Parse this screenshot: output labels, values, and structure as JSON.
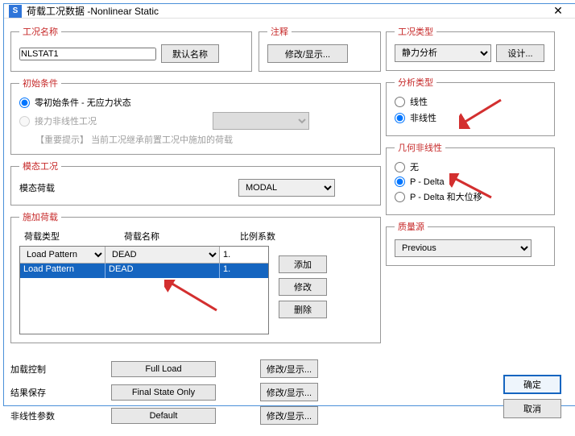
{
  "window": {
    "appicon_text": "S",
    "title": "荷载工况数据 -Nonlinear Static",
    "close_glyph": "✕"
  },
  "left": {
    "name_group": "工况名称",
    "name_value": "NLSTAT1",
    "default_name_btn": "默认名称",
    "comment_group": "注释",
    "comment_btn": "修改/显示...",
    "initial_group": "初始条件",
    "radio_zero": "零初始条件 - 无应力状态",
    "radio_cont": "接力非线性工况",
    "hint_label": "【重要提示】",
    "hint_text": "当前工况继承前置工况中施加的荷载",
    "modal_group": "模态工况",
    "modal_load_label": "模态荷载",
    "modal_select": "MODAL",
    "applied_group": "施加荷载",
    "col_type": "荷载类型",
    "col_name": "荷载名称",
    "col_scale": "比例系数",
    "dd_type": "Load Pattern",
    "dd_name": "DEAD",
    "dd_scale": "1.",
    "row1": {
      "type": "Load Pattern",
      "name": "DEAD",
      "scale": "1."
    },
    "btn_add": "添加",
    "btn_mod": "修改",
    "btn_del": "删除",
    "bottom": {
      "load_ctrl_label": "加载控制",
      "load_ctrl_val": "Full Load",
      "result_label": "结果保存",
      "result_val": "Final State Only",
      "nl_label": "非线性参数",
      "nl_val": "Default",
      "mod_btn": "修改/显示..."
    }
  },
  "right": {
    "type_group": "工况类型",
    "type_select": "静力分析",
    "design_btn": "设计...",
    "analysis_group": "分析类型",
    "radio_linear": "线性",
    "radio_nonlinear": "非线性",
    "geo_group": "几何非线性",
    "radio_none": "无",
    "radio_pdelta": "P - Delta",
    "radio_pdelta_ld": "P - Delta 和大位移",
    "mass_group": "质量源",
    "mass_select": "Previous"
  },
  "footer": {
    "ok": "确定",
    "cancel": "取消"
  }
}
